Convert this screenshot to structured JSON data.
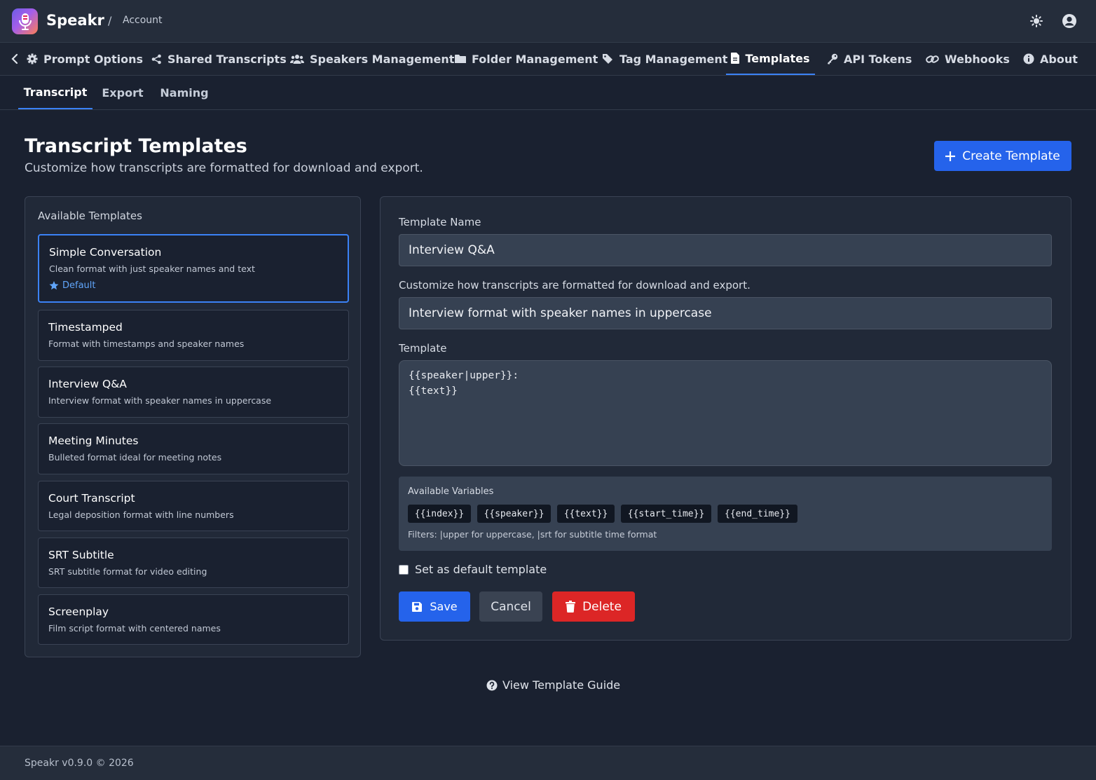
{
  "header": {
    "brand": "Speakr",
    "separator": "/",
    "breadcrumb": "Account",
    "icons": [
      "microphone-logo-icon",
      "sun-icon",
      "user-circle-icon"
    ]
  },
  "nav": {
    "items": [
      {
        "label": "Prompt Options",
        "icon": "gear-icon"
      },
      {
        "label": "Shared Transcripts",
        "icon": "share-icon"
      },
      {
        "label": "Speakers Management",
        "icon": "users-icon"
      },
      {
        "label": "Folder Management",
        "icon": "folder-icon"
      },
      {
        "label": "Tag Management",
        "icon": "tags-icon"
      },
      {
        "label": "Templates",
        "icon": "file-icon",
        "active": true
      },
      {
        "label": "API Tokens",
        "icon": "key-icon"
      },
      {
        "label": "Webhooks",
        "icon": "link-icon"
      },
      {
        "label": "About",
        "icon": "info-icon"
      }
    ]
  },
  "subtabs": [
    {
      "label": "Transcript",
      "active": true
    },
    {
      "label": "Export"
    },
    {
      "label": "Naming"
    }
  ],
  "page": {
    "title": "Transcript Templates",
    "subtitle": "Customize how transcripts are formatted for download and export.",
    "create_button": "Create Template"
  },
  "templates_panel": {
    "heading": "Available Templates",
    "default_badge": "Default",
    "items": [
      {
        "name": "Simple Conversation",
        "description": "Clean format with just speaker names and text",
        "is_default": true,
        "selected": true
      },
      {
        "name": "Timestamped",
        "description": "Format with timestamps and speaker names"
      },
      {
        "name": "Interview Q&A",
        "description": "Interview format with speaker names in uppercase"
      },
      {
        "name": "Meeting Minutes",
        "description": "Bulleted format ideal for meeting notes"
      },
      {
        "name": "Court Transcript",
        "description": "Legal deposition format with line numbers"
      },
      {
        "name": "SRT Subtitle",
        "description": "SRT subtitle format for video editing"
      },
      {
        "name": "Screenplay",
        "description": "Film script format with centered names"
      }
    ]
  },
  "editor": {
    "name_label": "Template Name",
    "name_value": "Interview Q&A",
    "description_label": "Customize how transcripts are formatted for download and export.",
    "description_value": "Interview format with speaker names in uppercase",
    "template_label": "Template",
    "template_value": "{{speaker|upper}}:\n{{text}}",
    "variables_title": "Available Variables",
    "variables": [
      "{{index}}",
      "{{speaker}}",
      "{{text}}",
      "{{start_time}}",
      "{{end_time}}"
    ],
    "filters_text": "Filters: |upper for uppercase, |srt for subtitle time format",
    "default_checkbox_label": "Set as default template",
    "default_checked": false,
    "save_label": "Save",
    "cancel_label": "Cancel",
    "delete_label": "Delete"
  },
  "guide_link": "View Template Guide",
  "footer": {
    "text": "Speakr v0.9.0 © 2026"
  },
  "colors": {
    "background": "#1a2130",
    "accent": "#2563eb",
    "danger": "#dc2626",
    "panel": "#212938"
  }
}
